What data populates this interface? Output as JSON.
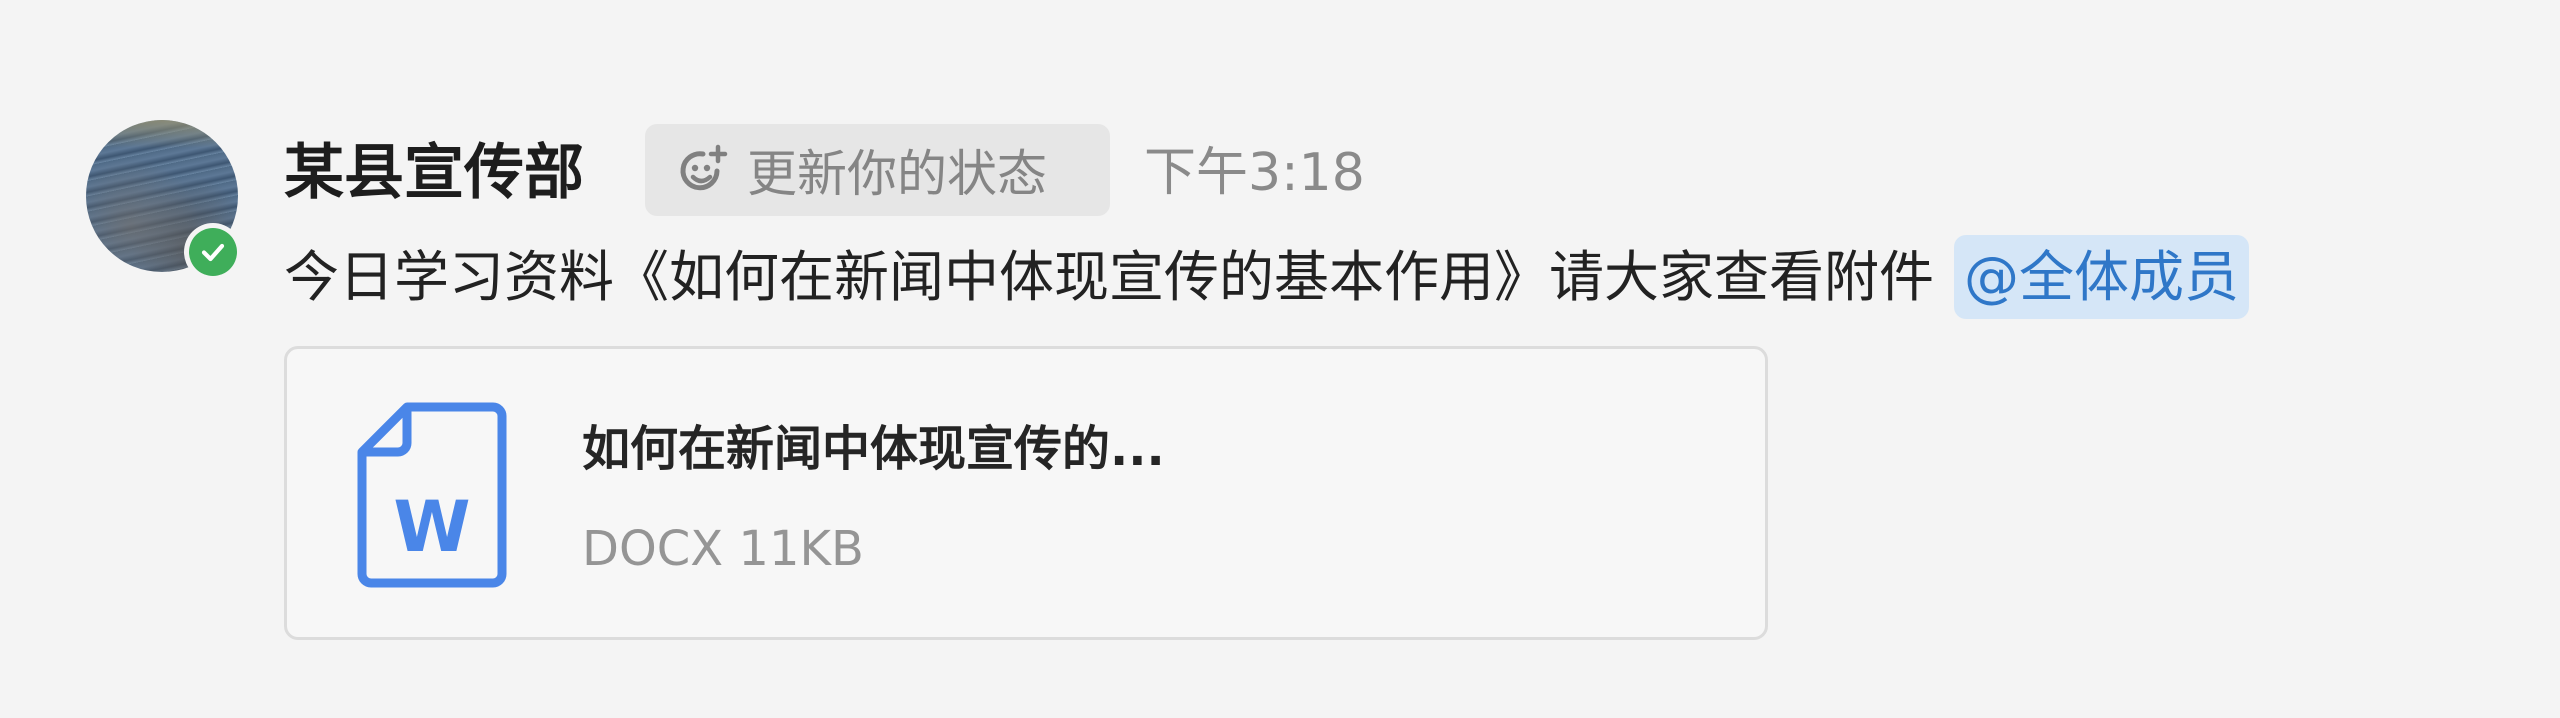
{
  "message": {
    "sender": {
      "name": "某县宣传部",
      "avatar": "landscape-photo-avatar",
      "presence": "online"
    },
    "status_button": {
      "icon": "smiley-plus-icon",
      "label": "更新你的状态"
    },
    "time": "下午3:18",
    "text": "今日学习资料《如何在新闻中体现宣传的基本作用》请大家查看附件",
    "mention": "@全体成员",
    "attachment": {
      "icon": "word-document-icon",
      "name": "如何在新闻中体现宣传的...",
      "type": "DOCX",
      "size": "11KB"
    }
  },
  "colors": {
    "background": "#f4f4f4",
    "online": "#3fae5a",
    "mention_bg": "#d5e6f7",
    "mention_text": "#2f77c8",
    "doc_icon": "#4a86e8"
  }
}
